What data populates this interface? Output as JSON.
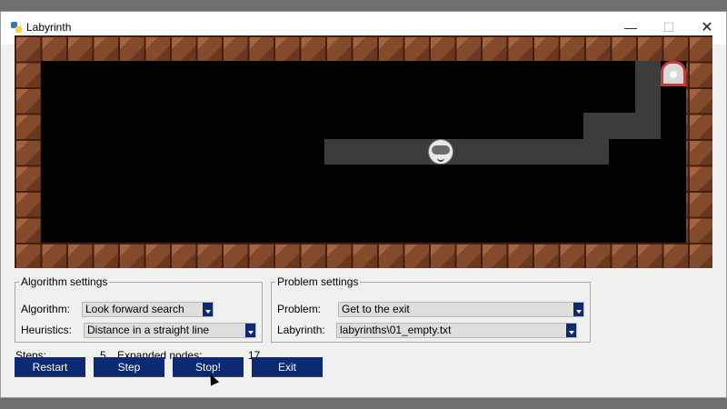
{
  "window": {
    "title": "Labyrinth",
    "controls": {
      "minimize": "—",
      "maximize": "☐",
      "close": "✕"
    }
  },
  "board": {
    "wall_color": "#7d4527",
    "floor_color": "#000000",
    "visited_color": "#3c3c3c",
    "agent_icon": "cat-face-icon",
    "exit_icon": "exit-door-icon"
  },
  "algorithm_settings": {
    "legend": "Algorithm settings",
    "algorithm_label": "Algorithm:",
    "algorithm_value": "Look forward search",
    "heuristics_label": "Heuristics:",
    "heuristics_value": "Distance in a straight line"
  },
  "problem_settings": {
    "legend": "Problem settings",
    "problem_label": "Problem:",
    "problem_value": "Get to the exit",
    "labyrinth_label": "Labyrinth:",
    "labyrinth_value": "labyrinths\\01_empty.txt"
  },
  "stats": {
    "steps_label": "Steps:",
    "steps_value": "5",
    "expanded_label": "Expanded nodes:",
    "expanded_value": "17"
  },
  "buttons": {
    "restart": "Restart",
    "step": "Step",
    "stop": "Stop!",
    "exit": "Exit"
  },
  "colors": {
    "button_bg": "#0b2a74",
    "button_fg": "#ffffff"
  }
}
